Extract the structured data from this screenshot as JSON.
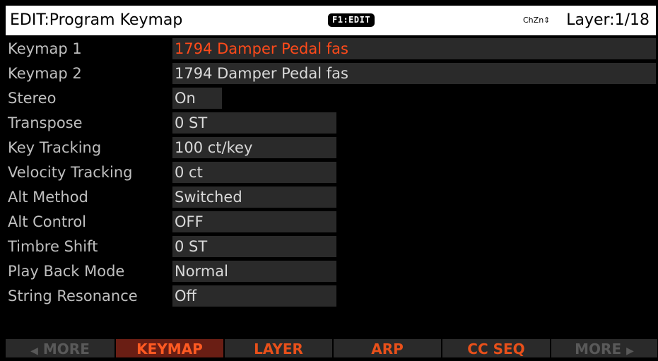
{
  "header": {
    "title": "EDIT:Program Keymap",
    "badge": "F1:EDIT",
    "chzn": "ChZn",
    "layer": "Layer:1/18"
  },
  "params": [
    {
      "label": "Keymap 1",
      "value": "1794 Damper Pedal fas",
      "selected": true
    },
    {
      "label": "Keymap 2",
      "value": "1794 Damper Pedal fas"
    },
    {
      "label": "Stereo",
      "value": "On"
    },
    {
      "label": "Transpose",
      "value": "0 ST"
    },
    {
      "label": "Key Tracking",
      "value": "100 ct/key"
    },
    {
      "label": "Velocity Tracking",
      "value": "0 ct"
    },
    {
      "label": "Alt Method",
      "value": "Switched"
    },
    {
      "label": "Alt Control",
      "value": "OFF"
    },
    {
      "label": "Timbre Shift",
      "value": "0 ST"
    },
    {
      "label": "Play Back Mode",
      "value": "Normal"
    },
    {
      "label": "String Resonance",
      "value": "Off"
    }
  ],
  "softbuttons": {
    "more_left": "MORE",
    "keymap": "KEYMAP",
    "layer": "LAYER",
    "arp": "ARP",
    "ccseq": "CC SEQ",
    "more_right": "MORE"
  },
  "icons": {
    "left_arrow": "left-triangle-arrow",
    "right_arrow": "right-triangle-arrow",
    "zone_arrows": "up-down-arrow"
  },
  "colors": {
    "selected_value": "#ff4a1a",
    "active_tab_bg": "#6a1e14",
    "tab_text": "#e8501a",
    "field_bg": "#2a2a2a"
  }
}
